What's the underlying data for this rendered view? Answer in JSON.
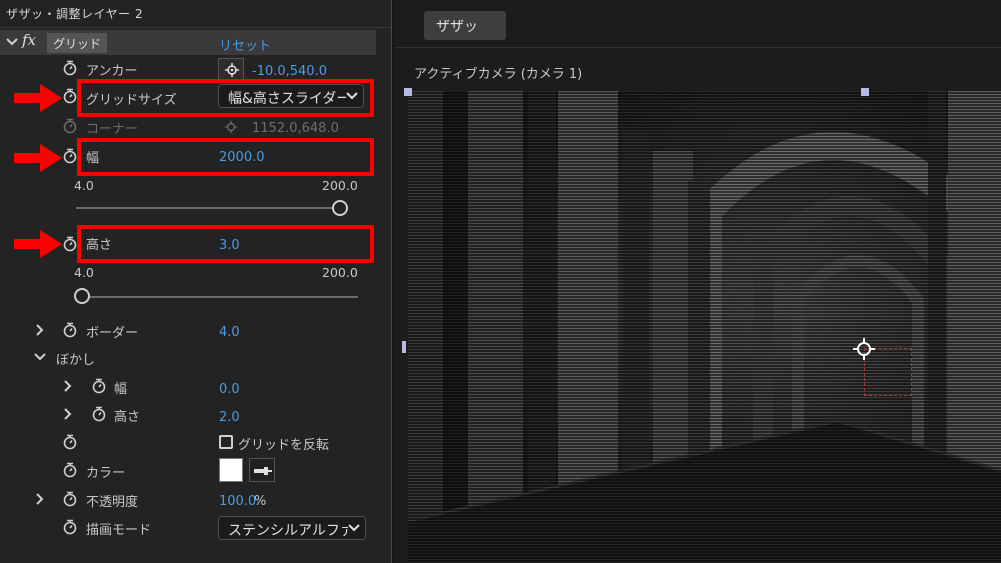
{
  "panel": {
    "title": "ザザッ・調整レイヤー 2",
    "effect": {
      "badge": "fx",
      "name": "グリッド",
      "reset": "リセット"
    }
  },
  "properties": {
    "anchor": {
      "label": "アンカー",
      "value": "-10.0,540.0"
    },
    "grid_size": {
      "label": "グリッドサイズ",
      "value": "幅&高さスライダー"
    },
    "corner": {
      "label": "コーナー",
      "value": "1152.0,648.0"
    },
    "width": {
      "label": "幅",
      "value": "2000.0",
      "min": "4.0",
      "max": "200.0",
      "slider_level": 1.0
    },
    "height": {
      "label": "高さ",
      "value": "3.0",
      "min": "4.0",
      "max": "200.0",
      "slider_level": 0.0
    },
    "border": {
      "label": "ボーダー",
      "value": "4.0"
    },
    "feather": {
      "label": "ぼかし",
      "width": {
        "label": "幅",
        "value": "0.0"
      },
      "height": {
        "label": "高さ",
        "value": "2.0"
      }
    },
    "invert": {
      "label": "グリッドを反転",
      "checked": false
    },
    "color": {
      "label": "カラー",
      "value": "#ffffff"
    },
    "opacity": {
      "label": "不透明度",
      "value": "100.0",
      "unit": "%"
    },
    "blend_mode": {
      "label": "描画モード",
      "value": "ステンシルアルファ"
    }
  },
  "monitor": {
    "tab": "ザザッ",
    "camera": "アクティブカメラ (カメラ 1)"
  },
  "colors": {
    "accent_blue": "#4a9be8",
    "highlight_red": "#ff0000",
    "panel_bg": "#232323"
  },
  "icons": [
    "chevron-down-icon",
    "chevron-right-icon",
    "stopwatch-icon",
    "anchor-target-icon",
    "eyedropper-icon",
    "red-arrow-icon"
  ]
}
